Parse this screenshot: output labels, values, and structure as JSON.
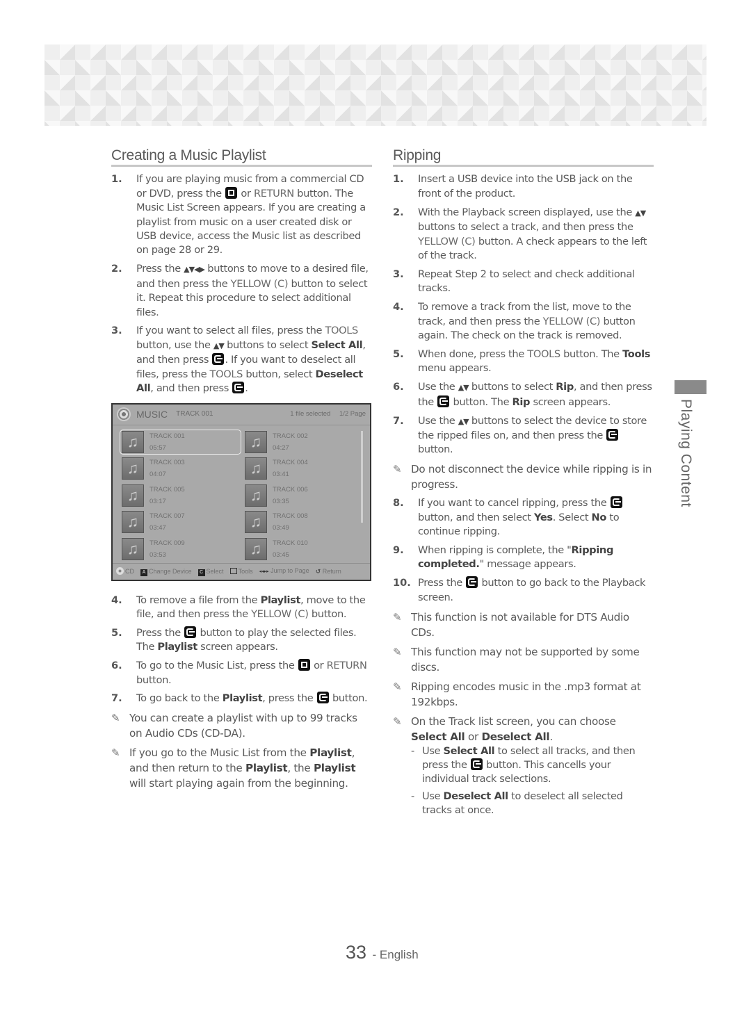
{
  "left": {
    "title": "Creating a Music Playlist",
    "steps": [
      {
        "num": "1.",
        "parts": [
          "If you are playing music from a commercial CD or DVD, press the ",
          "[stop]",
          " or ",
          "RETURN",
          " button. The Music List Screen appears. If you are creating a playlist from music on a user created disk or USB device, access the Music list as described on page 28 or 29."
        ]
      },
      {
        "num": "2.",
        "text_a": "Press the",
        "arrows": "▲▼◀▶",
        "text_b": "buttons to move to a desired file, and then press the",
        "hl": "YELLOW (C)",
        "text_c": "button to select it. Repeat this procedure to select additional files."
      },
      {
        "num": "3.",
        "text_a": "If you want to select all files, press the",
        "hl1": "TOOLS",
        "text_b": "button, use the",
        "arrows": "▲▼",
        "text_c": "buttons to select",
        "b1": "Select All",
        "text_d": ", and then press",
        "text_e": ". If you want to deselect all files, press the",
        "hl2": "TOOLS",
        "text_f": "button, select",
        "b2": "Deselect All",
        "text_g": ", and then press",
        "text_h": "."
      },
      {
        "num": "4.",
        "text_a": "To remove a file from the",
        "b1": "Playlist",
        "text_b": ", move to the file, and then press the",
        "hl": "YELLOW (C)",
        "text_c": "button."
      },
      {
        "num": "5.",
        "text_a": "Press the",
        "text_b": "button to play the selected files. The",
        "b1": "Playlist",
        "text_c": "screen appears."
      },
      {
        "num": "6.",
        "text_a": "To go to the Music List, press the",
        "text_b": "or",
        "hl": "RETURN",
        "text_c": "button."
      },
      {
        "num": "7.",
        "text_a": "To go back to the",
        "b1": "Playlist",
        "text_b": ", press the",
        "text_c": "button."
      }
    ],
    "step1": {
      "a": "If you are playing music from a commercial CD or DVD, press the",
      "b": "or",
      "hl": "RETURN",
      "c": "button. The Music List Screen appears. If you are creating a playlist from music on a user created disk or USB device, access the Music list as described on page 28 or 29."
    },
    "notes": [
      {
        "text": "You can create a playlist with up to 99 tracks on Audio CDs (CD-DA)."
      },
      {
        "a": "If you go to the Music List from the",
        "b1": "Playlist",
        "b": ", and then return to the",
        "b2": "Playlist",
        "c": ", the",
        "b3": "Playlist",
        "d": "will start playing again from the beginning."
      }
    ]
  },
  "screen": {
    "heading": "MUSIC",
    "current": "TRACK 001",
    "selected_count": "1 file selected",
    "page": "1/2 Page",
    "tracks": [
      {
        "name": "TRACK 001",
        "time": "05:57",
        "checked": true
      },
      {
        "name": "TRACK 002",
        "time": "04:27"
      },
      {
        "name": "TRACK 003",
        "time": "04:07"
      },
      {
        "name": "TRACK 004",
        "time": "03:41"
      },
      {
        "name": "TRACK 005",
        "time": "03:17"
      },
      {
        "name": "TRACK 006",
        "time": "03:35"
      },
      {
        "name": "TRACK 007",
        "time": "03:47"
      },
      {
        "name": "TRACK 008",
        "time": "03:49"
      },
      {
        "name": "TRACK 009",
        "time": "03:53"
      },
      {
        "name": "TRACK 010",
        "time": "03:45"
      }
    ],
    "footer": {
      "cd": "CD",
      "a_key": "A",
      "change_device": "Change Device",
      "c_key": "C",
      "select": "Select",
      "tools": "Tools",
      "jump_icon": "◂◂▸▸",
      "jump": "Jump to Page",
      "return_icon": "↺",
      "return": "Return"
    }
  },
  "right": {
    "title": "Ripping",
    "s1": {
      "num": "1.",
      "text": "Insert a USB device into the USB jack on the front of the product."
    },
    "s2": {
      "num": "2.",
      "a": "With the Playback screen displayed, use the",
      "arrows": "▲▼",
      "b": "buttons to select a track, and then press the",
      "hl": "YELLOW (C)",
      "c": "button. A check appears to the left of the track."
    },
    "s3": {
      "num": "3.",
      "text": "Repeat Step 2 to select and check additional tracks."
    },
    "s4": {
      "num": "4.",
      "a": "To remove a track from the list, move to the track, and then press the",
      "hl": "YELLOW (C)",
      "b": "button again. The check on the track is removed."
    },
    "s5": {
      "num": "5.",
      "a": "When done, press the",
      "hl": "TOOLS",
      "b": "button. The",
      "b1": "Tools",
      "c": "menu appears."
    },
    "s6": {
      "num": "6.",
      "a": "Use the",
      "arrows": "▲▼",
      "b": "buttons to select",
      "b1": "Rip",
      "c": ", and then press the",
      "d": "button. The",
      "b2": "Rip",
      "e": "screen appears."
    },
    "s7": {
      "num": "7.",
      "a": "Use the",
      "arrows": "▲▼",
      "b": "buttons to select the device to store the ripped files on, and then press the",
      "c": "button."
    },
    "n1": "Do not disconnect the device while ripping is in progress.",
    "s8": {
      "num": "8.",
      "a": "If you want to cancel ripping, press the",
      "b": "button, and then select",
      "b1": "Yes",
      "c": ". Select",
      "b2": "No",
      "d": "to continue ripping."
    },
    "s9": {
      "num": "9.",
      "a": "When ripping is complete, the \"",
      "b1": "Ripping completed.",
      "b": "\" message appears."
    },
    "s10": {
      "num": "10.",
      "a": "Press the",
      "b": "button to go back to the Playback screen."
    },
    "n2": "This function is not available for DTS Audio CDs.",
    "n3": "This function may not be supported by some discs.",
    "n4": "Ripping encodes music in the .mp3 format at 192kbps.",
    "n5": {
      "a": "On the Track list screen, you can choose",
      "b1": "Select All",
      "b": "or",
      "b2": "Deselect All",
      "c": "."
    },
    "sub1": {
      "dash": "-",
      "a": "Use",
      "b1": "Select All",
      "b": "to select all tracks, and then press the",
      "c": "button. This cancells your individual track selections."
    },
    "sub2": {
      "dash": "-",
      "a": "Use",
      "b1": "Deselect All",
      "b": "to deselect all selected tracks at once."
    }
  },
  "side_tab": {
    "label": "Playing Content"
  },
  "footer": {
    "page_number": "33",
    "separator": "-",
    "language": "English"
  },
  "icons": {
    "pencil": "✎"
  }
}
